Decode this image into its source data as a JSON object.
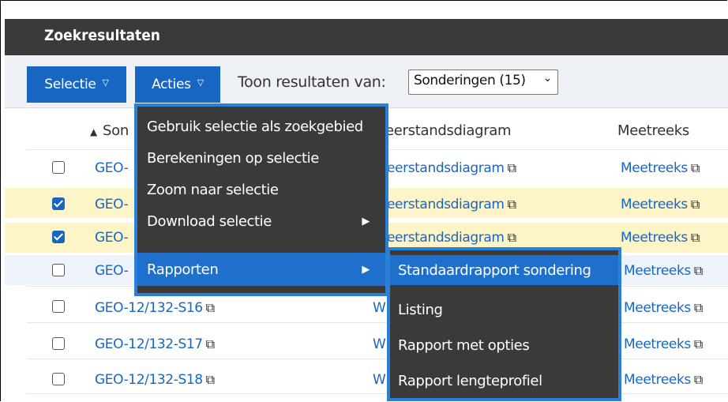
{
  "panel": {
    "title": "Zoekresultaten"
  },
  "toolbar": {
    "selectie_label": "Selectie",
    "acties_label": "Acties",
    "toon_label": "Toon resultaten van:",
    "select_value": "Sonderingen (15)"
  },
  "table": {
    "headers": {
      "col1": "Son",
      "col2": "eerstandsdiagram",
      "col3": "Meetreeks"
    },
    "rows": [
      {
        "checked": false,
        "id": "GEO-",
        "diagram": "eerstandsdiagram",
        "meetreeks": "Meetreeks"
      },
      {
        "checked": true,
        "id": "GEO-",
        "diagram": "eerstandsdiagram",
        "meetreeks": "Meetreeks"
      },
      {
        "checked": true,
        "id": "GEO-",
        "diagram": "eerstandsdiagram",
        "meetreeks": "Meetreeks"
      },
      {
        "checked": false,
        "id": "GEO-",
        "diagram": "",
        "meetreeks": "Meetreeks"
      },
      {
        "checked": false,
        "id": "GEO-12/132-S16",
        "diagram": "W",
        "meetreeks": "Meetreeks"
      },
      {
        "checked": false,
        "id": "GEO-12/132-S17",
        "diagram": "W",
        "meetreeks": "Meetreeks"
      },
      {
        "checked": false,
        "id": "GEO-12/132-S18",
        "diagram": "W",
        "meetreeks": "Meetreeks"
      }
    ]
  },
  "menus": {
    "acties": [
      {
        "label": "Gebruik selectie als zoekgebied",
        "submenu": false
      },
      {
        "label": "Berekeningen op selectie",
        "submenu": false
      },
      {
        "label": "Zoom naar selectie",
        "submenu": false
      },
      {
        "label": "Download selectie",
        "submenu": true
      },
      {
        "label": "Rapporten",
        "submenu": true
      }
    ],
    "rapporten": [
      {
        "label": "Standaardrapport sondering"
      },
      {
        "label": "Listing"
      },
      {
        "label": "Rapport met opties"
      },
      {
        "label": "Rapport lengteprofiel"
      }
    ]
  },
  "icons": {
    "caret": "▽",
    "sort_asc": "▲",
    "external": "⧉",
    "chevron": "⌄",
    "submenu_arrow": "▶"
  },
  "colors": {
    "accent": "#1766c2",
    "menu_bg": "#3a3a3a",
    "menu_border": "#2a7fd6",
    "selected_row": "#fdf4c8"
  }
}
